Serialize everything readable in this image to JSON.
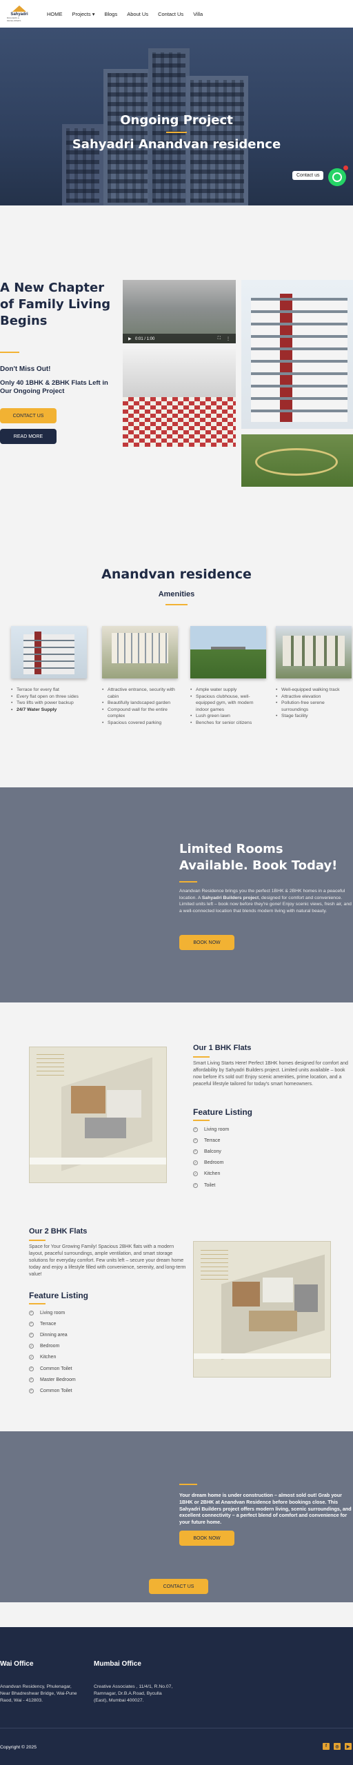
{
  "nav": {
    "logo_title": "Sahyadri",
    "logo_subtitle": "BUILDERS & DEVELOPERS",
    "items": [
      "HOME",
      "Projects",
      "Blogs",
      "About Us",
      "Contact Us",
      "Villa"
    ]
  },
  "hero": {
    "title": "Ongoing Project",
    "subtitle": "Sahyadri Anandvan residence",
    "whatsapp_label": "Contact us"
  },
  "chapter": {
    "heading": "A New Chapter of Family Living Begins",
    "dont_miss": "Don't Miss Out!",
    "only": "Only 40 1BHK & 2BHK Flats Left in Our Ongoing Project",
    "contact_btn": "CONTACT US",
    "read_btn": "READ MORE",
    "video_time": "0:01 / 1:00"
  },
  "amenities": {
    "title": "Anandvan residence",
    "subtitle": "Amenities",
    "cards": [
      {
        "items": [
          "Terrace for every flat",
          "Every flat open on three sides",
          "Two lifts with power backup",
          "24/7 Water Supply"
        ]
      },
      {
        "items": [
          "Attractive entrance, security with cabin",
          "Beautifully landscaped garden",
          "Compound wall for the entire complex",
          "Spacious covered parking"
        ]
      },
      {
        "items": [
          "Ample water supply",
          "Spacious clubhouse, well-equipped gym, with modern indoor games",
          "Lush green lawn",
          "Benches for senior citizens"
        ]
      },
      {
        "items": [
          "Well-equipped walking track",
          "Attractive elevation",
          "Pollution-free serene surroundings",
          "Stage facility"
        ]
      }
    ]
  },
  "limited": {
    "title": "Limited Rooms Available. Book Today!",
    "text_a": "Anandvan Residence brings you the perfect 1BHK & 2BHK homes in a peaceful location. A ",
    "text_bold": "Sahyadri Builders project",
    "text_b": ", designed for comfort and convenience. Limited units left – book now before they're gone! Enjoy scenic views, fresh air, and a well-connected location that blends modern living with natural beauty.",
    "button": "BOOK NOW"
  },
  "flat1": {
    "title": "Our 1 BHK Flats",
    "desc": "Smart Living Starts Here! Perfect 1BHK homes designed for comfort and affordability by Sahyadri Builders project. Limited units available – book now before it's sold out! Enjoy scenic amenities, prime location, and a peaceful lifestyle tailored for today's smart homeowners.",
    "feature_title": "Feature Listing",
    "features": [
      "Living room",
      "Terrace",
      "Balcony",
      "Bedroom",
      "Kitchen",
      "Toilet"
    ]
  },
  "flat2": {
    "title": "Our 2 BHK Flats",
    "desc": "Space for Your Growing Family! Spacious 2BHK flats with a modern layout, peaceful surroundings, ample ventilation, and smart storage solutions for everyday comfort. Few units left – secure your dream home today and enjoy a lifestyle filled with convenience, serenity, and long-term value!",
    "feature_title": "Feature Listing",
    "features": [
      "Living room",
      "Terrace",
      "Dinning area",
      "Bedroom",
      "Kitchen",
      "Common Toilet",
      "Master Bedroom",
      "Common Toilet"
    ]
  },
  "under": {
    "text": "Your dream home is under construction – almost sold out! Grab your 1BHK or 2BHK at Anandvan Residence before bookings close. This Sahyadri Builders project offers modern living, scenic surroundings, and excellent connectivity – a perfect blend of comfort and convenience for your future home.",
    "button": "BOOK NOW",
    "contact": "CONTACT US"
  },
  "footer": {
    "wai_title": "Wai Office",
    "wai_address": "Anandvan Residency, Phulenagar, Near Bhadreshwar Bridge, Wai-Pune Raod, Wai - 412803.",
    "mumbai_title": "Mumbai Office",
    "mumbai_address": "Creative Associates , 11/4/1, R.No.07, Ramnagar, Dr.B.A.Road, Byculla (East), Mumbai 400027.",
    "copyright": "Copyright © 2025"
  },
  "colors": {
    "accent": "#f2b233",
    "navy": "#1f2a44",
    "slate": "#6c7485"
  }
}
